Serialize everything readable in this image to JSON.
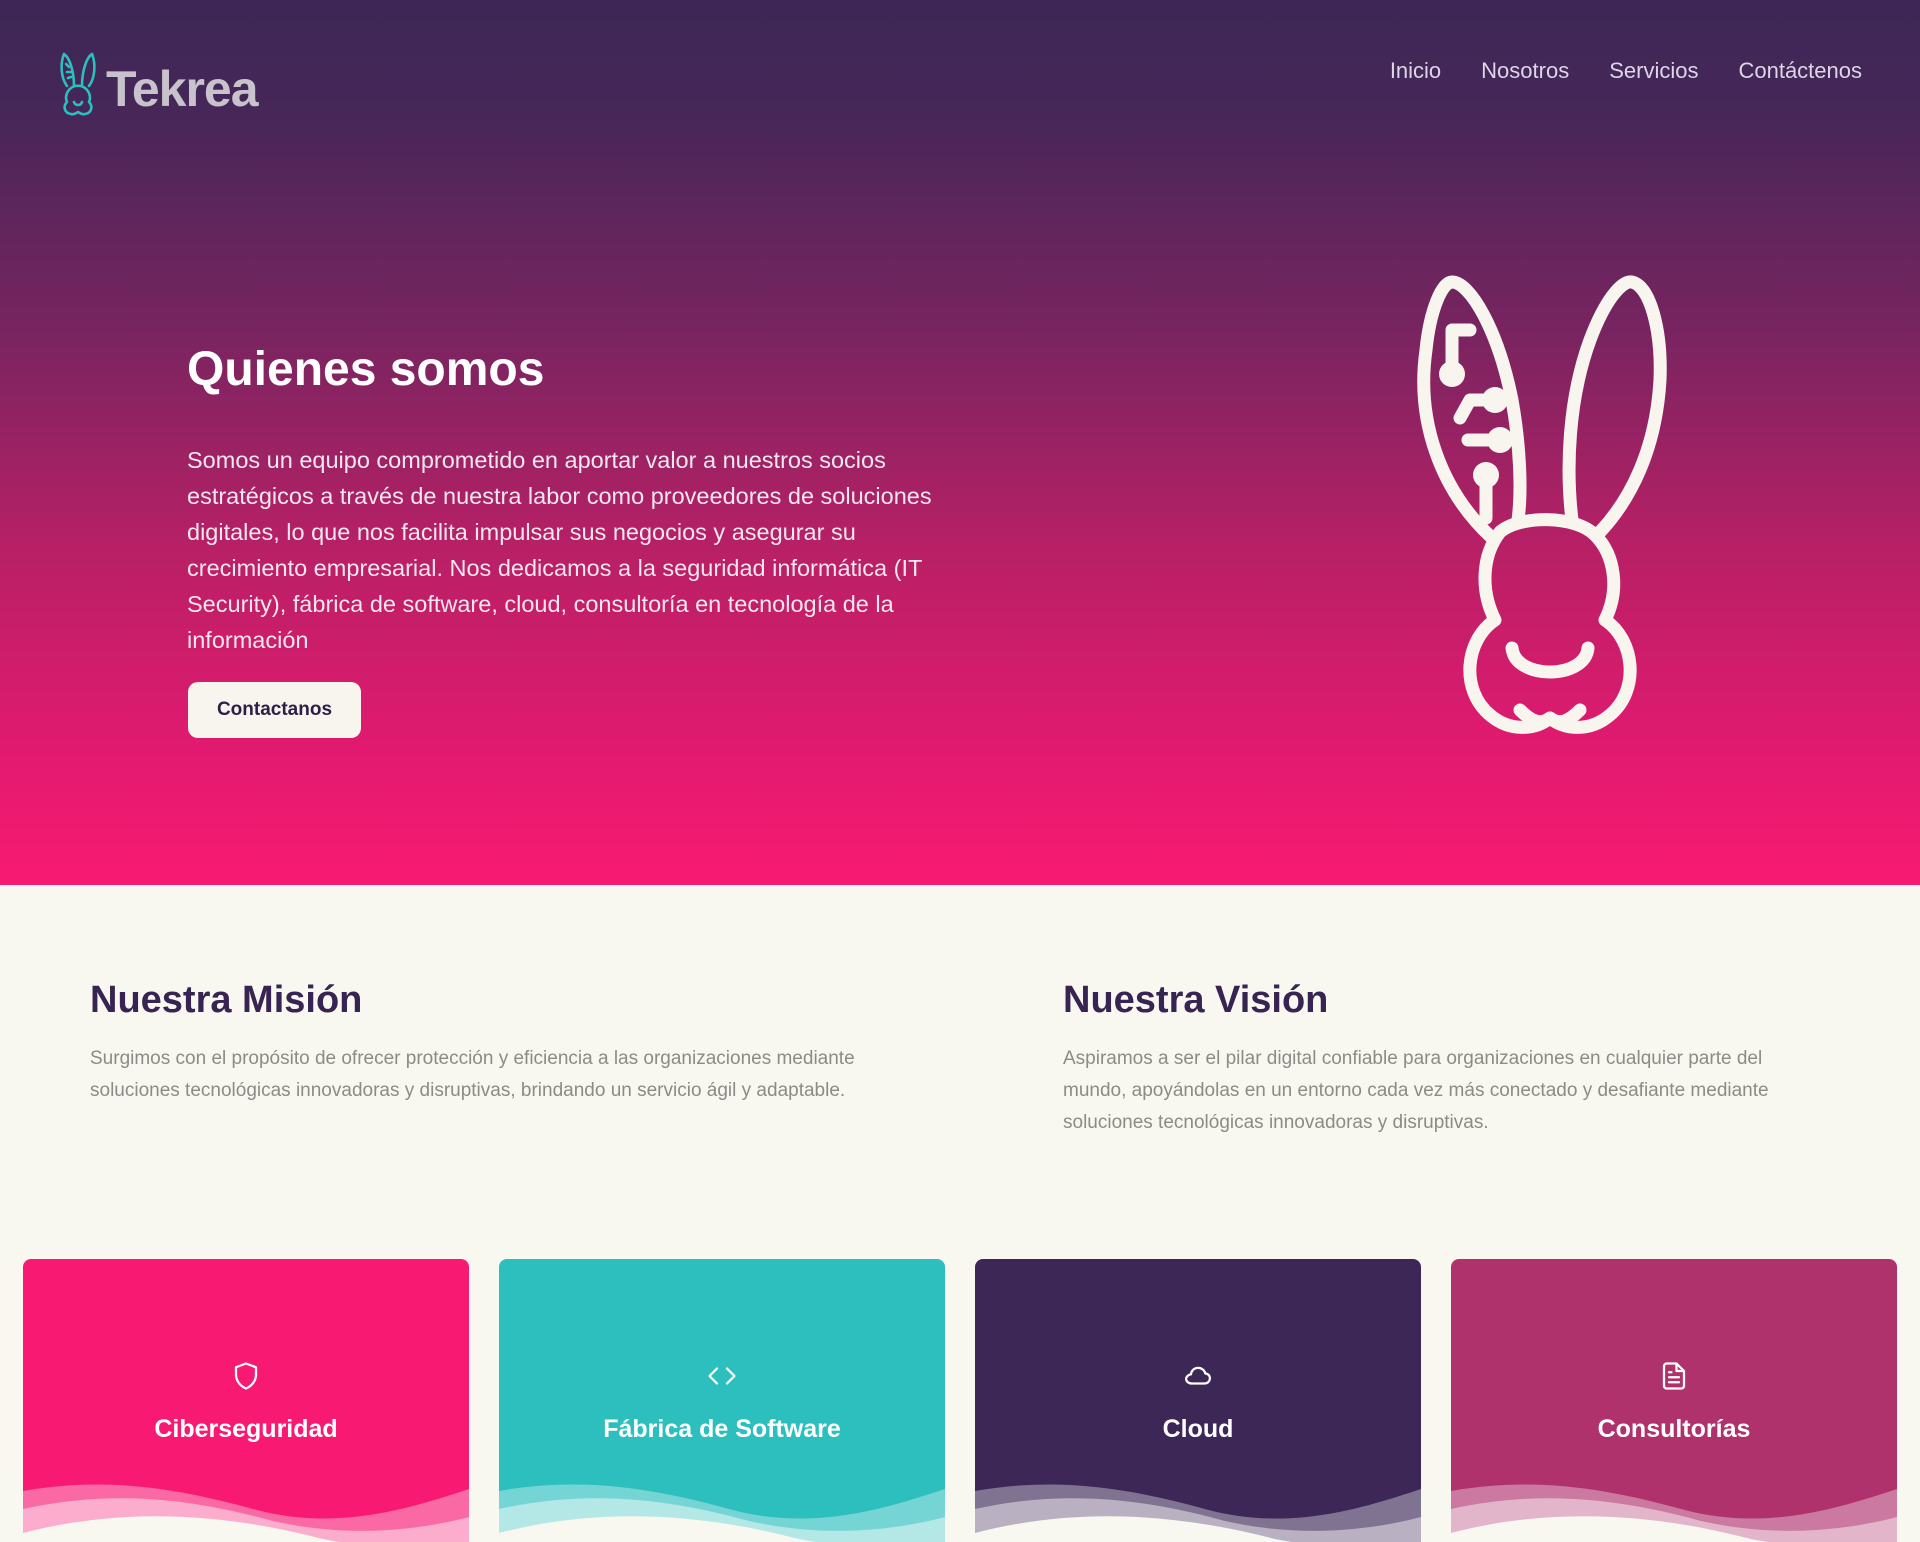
{
  "brand": {
    "name": "Tekrea",
    "logo_icon": "bunny-circuit-icon"
  },
  "nav": {
    "items": [
      {
        "label": "Inicio"
      },
      {
        "label": "Nosotros"
      },
      {
        "label": "Servicios"
      },
      {
        "label": "Contáctenos"
      }
    ]
  },
  "hero": {
    "title": "Quienes somos",
    "text": "Somos un equipo comprometido en aportar valor a nuestros socios estratégicos a través de nuestra labor como proveedores de soluciones digitales, lo que nos facilita impulsar sus negocios y asegurar su crecimiento empresarial. Nos dedicamos a la seguridad informática (IT Security), fábrica de software, cloud, consultoría en tecnología de la información",
    "cta_label": "Contactanos",
    "illustration": "bunny-circuit-icon"
  },
  "mission": {
    "title": "Nuestra Misión",
    "text": "Surgimos con el propósito de ofrecer protección y eficiencia a las organizaciones mediante soluciones tecnológicas innovadoras y disruptivas, brindando un servicio ágil y adaptable."
  },
  "vision": {
    "title": "Nuestra Visión",
    "text": "Aspiramos a ser el pilar digital confiable para organizaciones en cualquier parte del mundo, apoyándolas en un entorno cada vez más conectado y desafiante mediante soluciones tecnológicas innovadoras y disruptivas."
  },
  "services": [
    {
      "title": "Ciberseguridad",
      "icon": "shield-icon",
      "color": "#f81a72"
    },
    {
      "title": "Fábrica de Software",
      "icon": "code-icon",
      "color": "#2cbfbe"
    },
    {
      "title": "Cloud",
      "icon": "cloud-icon",
      "color": "#3d2756"
    },
    {
      "title": "Consultorías",
      "icon": "document-icon",
      "color": "#b0326d"
    }
  ],
  "colors": {
    "hero_top": "#3d2756",
    "hero_bottom": "#f81a72",
    "page_bg": "#f8f7f0",
    "heading": "#372452",
    "teal": "#2cbfbe"
  }
}
